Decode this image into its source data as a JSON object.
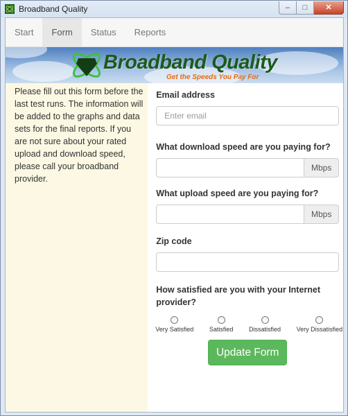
{
  "window": {
    "title": "Broadband Quality"
  },
  "nav": {
    "items": [
      "Start",
      "Form",
      "Status",
      "Reports"
    ],
    "active": "Form"
  },
  "banner": {
    "title": "Broadband Quality",
    "tagline": "Get the Speeds You Pay For"
  },
  "intro": {
    "text": "Please fill out this form before the last test runs. The information will be added to the graphs and data sets for the final reports. If you are not sure about your rated upload and download speed, please call your broadband provider."
  },
  "form": {
    "email": {
      "label": "Email address",
      "placeholder": "Enter email",
      "value": ""
    },
    "download": {
      "label": "What download speed are you paying for?",
      "unit": "Mbps",
      "value": ""
    },
    "upload": {
      "label": "What upload speed are you paying for?",
      "unit": "Mbps",
      "value": ""
    },
    "zip": {
      "label": "Zip code",
      "value": ""
    },
    "satisfaction": {
      "label": "How satisfied are you with your Internet provider?",
      "options": [
        "Very Satisfied",
        "Satisfied",
        "Dissatisfied",
        "Very Dissatisfied"
      ],
      "selected": null
    },
    "submit_label": "Update Form"
  },
  "colors": {
    "button": "#5cb85c",
    "intro_bg": "#fcf8e3",
    "banner_title": "#1d5a1d",
    "tagline": "#e86a12"
  }
}
